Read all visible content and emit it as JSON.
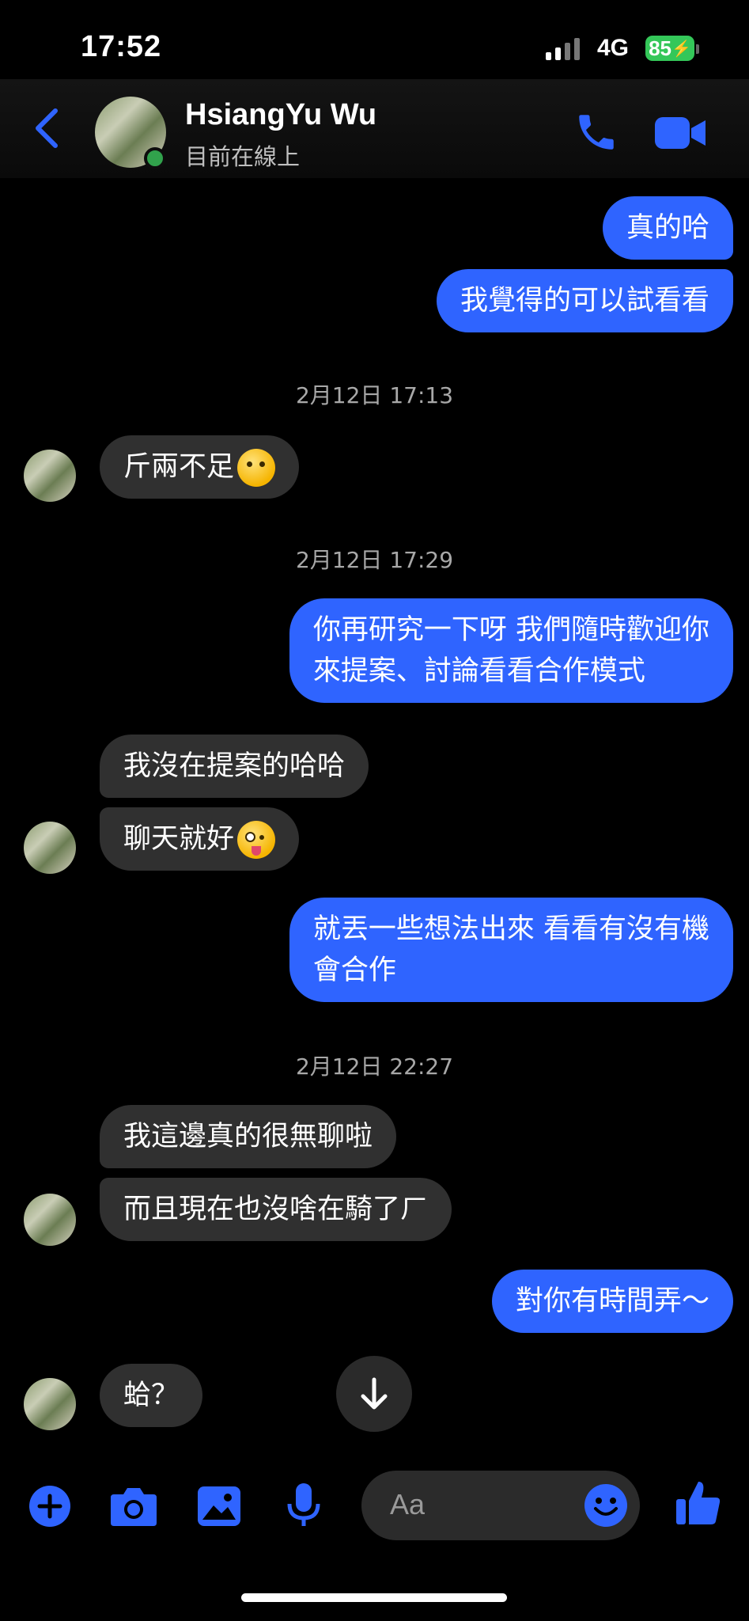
{
  "status_bar": {
    "time": "17:52",
    "network": "4G",
    "battery": "85"
  },
  "header": {
    "contact_name": "HsiangYu Wu",
    "contact_status": "目前在線上",
    "icons": [
      "back-chevron-icon",
      "phone-icon",
      "video-camera-icon"
    ]
  },
  "messages": [
    {
      "side": "out",
      "text": "真的哈"
    },
    {
      "side": "out",
      "text": "我覺得的可以試看看"
    },
    {
      "type": "timestamp",
      "text": "2月12日 17:13"
    },
    {
      "side": "in",
      "text": "斤兩不足",
      "emoji": "melting-face"
    },
    {
      "type": "timestamp",
      "text": "2月12日 17:29"
    },
    {
      "side": "out",
      "lines": [
        "你再研究一下呀 我們隨時歡迎你",
        "來提案、討論看看合作模式"
      ]
    },
    {
      "side": "in",
      "text": "我沒在提案的哈哈"
    },
    {
      "side": "in",
      "text": "聊天就好",
      "emoji": "zany-face"
    },
    {
      "side": "out",
      "lines": [
        "就丟一些想法出來 看看有沒有機",
        "會合作"
      ]
    },
    {
      "type": "timestamp",
      "text": "2月12日 22:27"
    },
    {
      "side": "in",
      "text": "我這邊真的很無聊啦"
    },
    {
      "side": "in",
      "text": "而且現在也沒啥在騎了ㄏ"
    },
    {
      "side": "out",
      "text": "對你有時間弄～"
    },
    {
      "side": "in",
      "text": "蛤？"
    }
  ],
  "composer": {
    "placeholder": "Aa",
    "icons": [
      "plus-icon",
      "camera-icon",
      "image-icon",
      "microphone-icon",
      "emoji-icon",
      "thumbs-up-icon"
    ]
  },
  "colors": {
    "outgoing": "#2f64ff",
    "incoming": "#303030",
    "accent": "#2f64ff",
    "online": "#31a24c"
  }
}
